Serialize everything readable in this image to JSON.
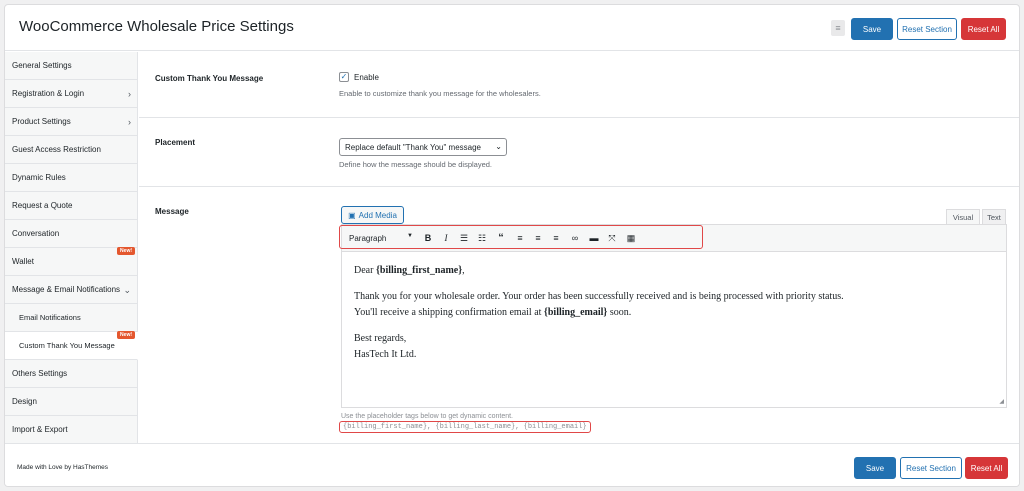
{
  "header": {
    "title": "WooCommerce Wholesale Price Settings",
    "icon": "list-icon",
    "save_label": "Save",
    "reset_section_label": "Reset Section",
    "reset_all_label": "Reset All"
  },
  "colors": {
    "primary": "#2271b1",
    "danger": "#d63638",
    "badge": "#e4572e",
    "highlight": "#e04848"
  },
  "sidebar": {
    "items": [
      {
        "label": "General Settings"
      },
      {
        "label": "Registration & Login",
        "chevron": "›"
      },
      {
        "label": "Product Settings",
        "chevron": "›"
      },
      {
        "label": "Guest Access Restriction"
      },
      {
        "label": "Dynamic Rules"
      },
      {
        "label": "Request a Quote"
      },
      {
        "label": "Conversation"
      },
      {
        "label": "Wallet",
        "badge": "New!"
      },
      {
        "label": "Message & Email Notifications",
        "chevron": "⌄"
      },
      {
        "label": "Email Notifications"
      },
      {
        "label": "Custom Thank You Message",
        "badge": "New!"
      },
      {
        "label": "Others Settings"
      },
      {
        "label": "Design"
      },
      {
        "label": "Import & Export"
      }
    ]
  },
  "main": {
    "custom_thank_you": {
      "label": "Custom Thank You Message",
      "checkbox_label": "Enable",
      "checked": "✓",
      "description": "Enable to customize thank you message for the wholesalers."
    },
    "placement": {
      "label": "Placement",
      "selected": "Replace default \"Thank You\" message",
      "description": "Define how the message should be displayed."
    },
    "message": {
      "label": "Message",
      "add_media_label": "Add Media",
      "tab_visual": "Visual",
      "tab_text": "Text",
      "format_select": "Paragraph",
      "greeting_prefix": "Dear ",
      "greeting_tag": "{billing_first_name}",
      "greeting_suffix": ",",
      "line1": "Thank you for your wholesale order. Your order has been successfully received and is being processed with priority status.",
      "line2_prefix": "You'll receive a shipping confirmation email at ",
      "line2_tag": "{billing_email}",
      "line2_suffix": " soon.",
      "signoff": "Best regards,",
      "company": "HasTech It Ltd.",
      "help_text": "Use the placeholder tags below to get dynamic content.",
      "tags": "{billing_first_name}, {billing_last_name}, {billing_email}"
    }
  },
  "footer": {
    "credit": "Made with Love by HasThemes",
    "save_label": "Save",
    "reset_section_label": "Reset Section",
    "reset_all_label": "Reset All"
  }
}
